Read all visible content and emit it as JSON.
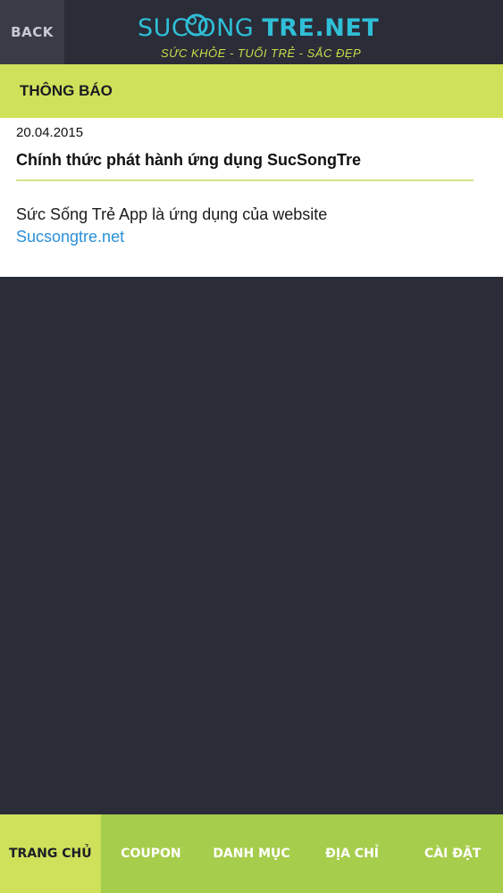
{
  "header": {
    "back_label": "BACK",
    "logo_name_a": "SUC  ONG",
    "logo_name_b": "TRE.NET",
    "logo_tagline": "SỨC KHỎE - TUỔI TRẺ - SẮC ĐẸP"
  },
  "section": {
    "title": "THÔNG BÁO"
  },
  "notice": {
    "date": "20.04.2015",
    "title": "Chính thức phát hành ứng dụng SucSongTre",
    "body": "Sức Sống Trẻ App là ứng dụng của website",
    "link": "Sucsongtre.net"
  },
  "footer": {
    "tabs": [
      {
        "label": "TRANG CHỦ"
      },
      {
        "label": "COUPON"
      },
      {
        "label": "DANH MỤC"
      },
      {
        "label": "ĐỊA CHỈ"
      },
      {
        "label": "CÀI ĐẶT"
      }
    ]
  },
  "colors": {
    "background": "#2a2c38",
    "accent": "#cfe15a",
    "footer": "#a7cd4c",
    "logo": "#2fbfd6",
    "link": "#2a8fd8"
  }
}
